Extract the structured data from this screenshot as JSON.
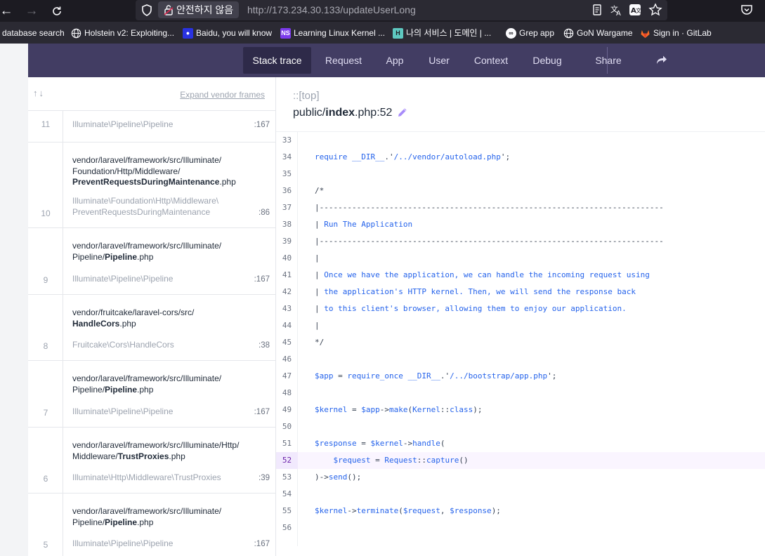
{
  "browser": {
    "insecure_label": "안전하지 않음",
    "url": "http://173.234.30.133/updateUserLong",
    "bookmarks": [
      {
        "label": "database search",
        "icon": "none"
      },
      {
        "label": "Holstein v2: Exploiting...",
        "icon": "globe-icon"
      },
      {
        "label": "Baidu, you will know",
        "icon": "baidu-icon"
      },
      {
        "label": "Learning Linux Kernel ...",
        "icon": "ns-icon"
      },
      {
        "label": "나의 서비스 | 도메인 | ...",
        "icon": "h-icon"
      },
      {
        "label": "Grep app",
        "icon": "grep-icon"
      },
      {
        "label": "GoN Wargame",
        "icon": "globe-icon"
      },
      {
        "label": "Sign in · GitLab",
        "icon": "gitlab-icon"
      }
    ]
  },
  "nav": {
    "tabs": [
      "Stack trace",
      "Request",
      "App",
      "User",
      "Context",
      "Debug"
    ],
    "active": "Stack trace",
    "share": "Share"
  },
  "frames_header": {
    "expand": "Expand vendor frames"
  },
  "frames": [
    {
      "number": "11",
      "file": [],
      "class": "Illuminate\\Pipeline\\Pipeline",
      "line": ":167"
    },
    {
      "number": "10",
      "file": [
        "vendor/laravel/framework/src/Illuminate/",
        "Foundation/Http/Middleware/",
        "**PreventRequestsDuringMaintenance**.php"
      ],
      "class": "Illuminate\\Foundation\\Http\\Middleware\\ PreventRequestsDuringMaintenance",
      "line": ":86"
    },
    {
      "number": "9",
      "file": [
        "vendor/laravel/framework/src/Illuminate/",
        "Pipeline/**Pipeline**.php"
      ],
      "class": "Illuminate\\Pipeline\\Pipeline",
      "line": ":167"
    },
    {
      "number": "8",
      "file": [
        "vendor/fruitcake/laravel-cors/src/",
        "**HandleCors**.php"
      ],
      "class": "Fruitcake\\Cors\\HandleCors",
      "line": ":38"
    },
    {
      "number": "7",
      "file": [
        "vendor/laravel/framework/src/Illuminate/",
        "Pipeline/**Pipeline**.php"
      ],
      "class": "Illuminate\\Pipeline\\Pipeline",
      "line": ":167"
    },
    {
      "number": "6",
      "file": [
        "vendor/laravel/framework/src/Illuminate/Http/",
        "Middleware/**TrustProxies**.php"
      ],
      "class": "Illuminate\\Http\\Middleware\\TrustProxies",
      "line": ":39"
    },
    {
      "number": "5",
      "file": [
        "vendor/laravel/framework/src/Illuminate/",
        "Pipeline/**Pipeline**.php"
      ],
      "class": "Illuminate\\Pipeline\\Pipeline",
      "line": ":167"
    }
  ],
  "code": {
    "top_label": "::[top]",
    "path_prefix": "public/",
    "path_bold": "index",
    "path_suffix": ".php:52",
    "highlight_line": 52,
    "lines": [
      {
        "n": "33",
        "t": ""
      },
      {
        "n": "34",
        "t": "require __DIR__.'/../vendor/autoload.php';"
      },
      {
        "n": "35",
        "t": ""
      },
      {
        "n": "36",
        "t": "/*"
      },
      {
        "n": "37",
        "t": "|--------------------------------------------------------------------------"
      },
      {
        "n": "38",
        "t": "| Run The Application"
      },
      {
        "n": "39",
        "t": "|--------------------------------------------------------------------------"
      },
      {
        "n": "40",
        "t": "|"
      },
      {
        "n": "41",
        "t": "| Once we have the application, we can handle the incoming request using"
      },
      {
        "n": "42",
        "t": "| the application's HTTP kernel. Then, we will send the response back"
      },
      {
        "n": "43",
        "t": "| to this client's browser, allowing them to enjoy our application."
      },
      {
        "n": "44",
        "t": "|"
      },
      {
        "n": "45",
        "t": "*/"
      },
      {
        "n": "46",
        "t": ""
      },
      {
        "n": "47",
        "t": "$app = require_once __DIR__.'/../bootstrap/app.php';"
      },
      {
        "n": "48",
        "t": ""
      },
      {
        "n": "49",
        "t": "$kernel = $app->make(Kernel::class);"
      },
      {
        "n": "50",
        "t": ""
      },
      {
        "n": "51",
        "t": "$response = $kernel->handle("
      },
      {
        "n": "52",
        "t": "    $request = Request::capture()"
      },
      {
        "n": "53",
        "t": ")->send();"
      },
      {
        "n": "54",
        "t": ""
      },
      {
        "n": "55",
        "t": "$kernel->terminate($request, $response);"
      },
      {
        "n": "56",
        "t": ""
      }
    ]
  }
}
